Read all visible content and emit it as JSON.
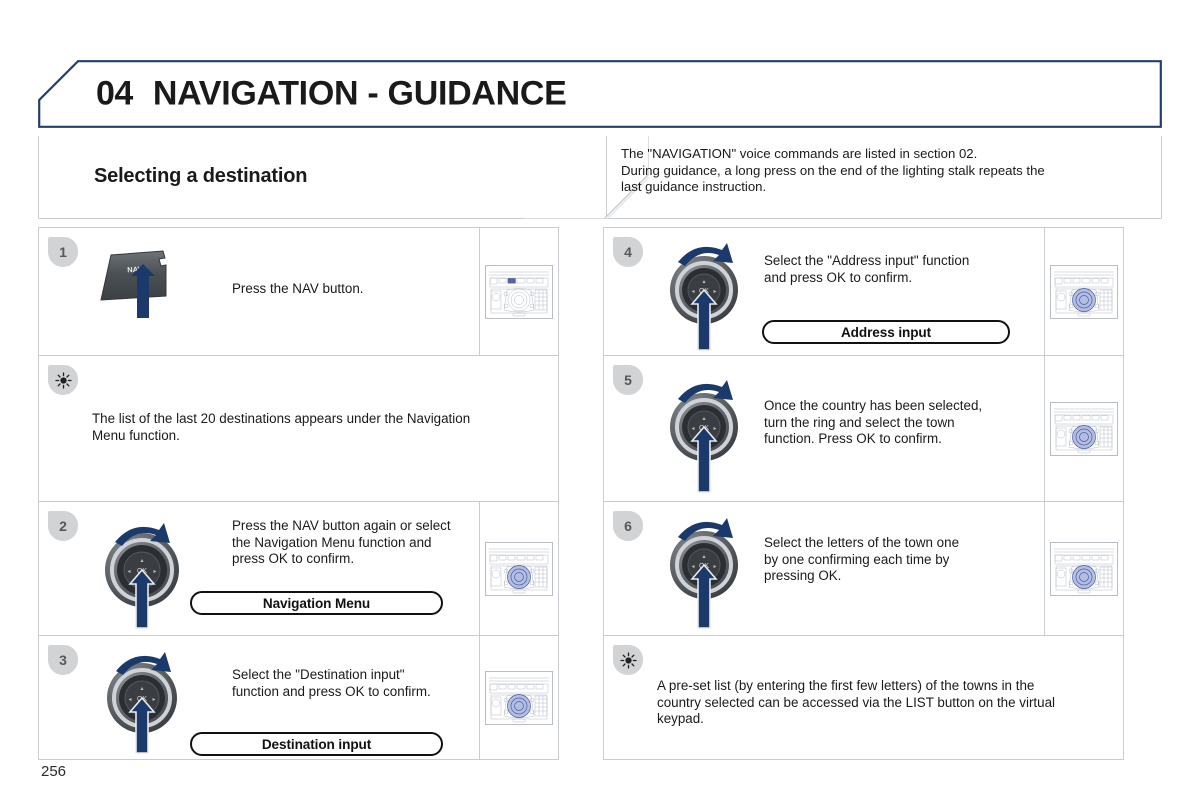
{
  "header": {
    "chapter_number": "04",
    "chapter_title": "NAVIGATION - GUIDANCE",
    "accent_color": "#23406b"
  },
  "section": {
    "title": "Selecting a destination"
  },
  "intro": {
    "line1": "The \"NAVIGATION\" voice commands are listed in section 02.",
    "line2": "During guidance, a long press on the end of the lighting stalk repeats the",
    "line3": "last guidance instruction."
  },
  "left_column": [
    {
      "kind": "step",
      "badge": "1",
      "illustration": "nav-button",
      "nav_button_label": "NAV",
      "text_lines": [
        "Press the NAV button."
      ],
      "pill": null,
      "thumb_highlight": "nav-key"
    },
    {
      "kind": "tip",
      "badge_icon": "sun-icon",
      "text_lines": [
        "The list of the last 20 destinations appears under the Navigation",
        "Menu function."
      ]
    },
    {
      "kind": "step",
      "badge": "2",
      "illustration": "rotary-knob",
      "text_lines": [
        "Press the NAV button again or select",
        "the Navigation Menu function and",
        "press OK to confirm."
      ],
      "pill": "Navigation Menu",
      "thumb_highlight": "rotary"
    },
    {
      "kind": "step",
      "badge": "3",
      "illustration": "rotary-knob",
      "text_lines": [
        "Select the \"Destination input\"",
        "function and press OK to confirm."
      ],
      "pill": "Destination input",
      "thumb_highlight": "rotary"
    }
  ],
  "right_column": [
    {
      "kind": "step",
      "badge": "4",
      "illustration": "rotary-knob",
      "text_lines": [
        "Select the \"Address input\" function",
        "and press OK to confirm."
      ],
      "pill": "Address input",
      "thumb_highlight": "rotary"
    },
    {
      "kind": "step",
      "badge": "5",
      "illustration": "rotary-knob",
      "text_lines": [
        "Once the country has been selected,",
        "turn the ring and select the town",
        "function. Press OK to confirm."
      ],
      "pill": null,
      "thumb_highlight": "rotary"
    },
    {
      "kind": "step",
      "badge": "6",
      "illustration": "rotary-knob",
      "text_lines": [
        "Select the letters of the town one",
        "by one confirming each time by",
        "pressing OK."
      ],
      "pill": null,
      "thumb_highlight": "rotary"
    },
    {
      "kind": "tip",
      "badge_icon": "sun-icon",
      "text_lines": [
        "A pre-set list (by entering the first few letters) of the towns in the",
        "country selected can be accessed via the LIST button on the virtual",
        "keypad."
      ]
    }
  ],
  "footer": {
    "page_number": "256"
  }
}
